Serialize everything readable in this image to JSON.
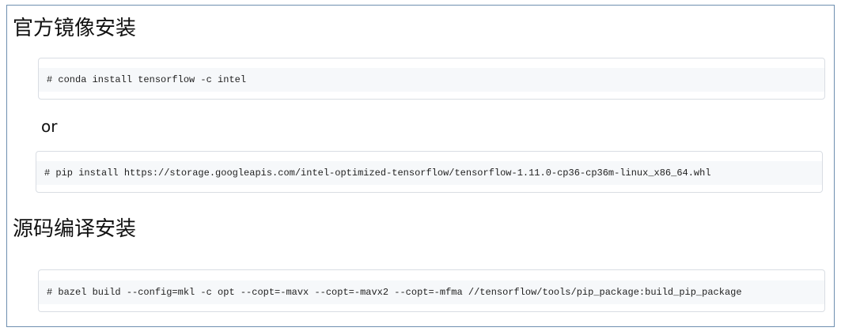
{
  "sections": [
    {
      "heading": "官方镜像安装",
      "commands": [
        "# conda install tensorflow -c intel"
      ],
      "separator": "or",
      "alt_commands": [
        "# pip install https://storage.googleapis.com/intel-optimized-tensorflow/tensorflow-1.11.0-cp36-cp36m-linux_x86_64.whl"
      ]
    },
    {
      "heading": "源码编译安装",
      "commands": [
        "# bazel build --config=mkl -c opt --copt=-mavx --copt=-mavx2 --copt=-mfma //tensorflow/tools/pip_package:build_pip_package"
      ]
    }
  ]
}
